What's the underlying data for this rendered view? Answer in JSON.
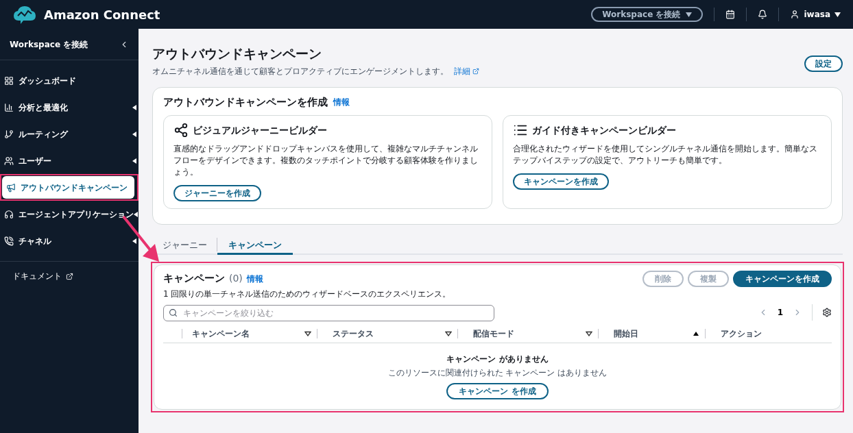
{
  "header": {
    "product": "Amazon Connect",
    "workspace_button": "Workspace を接続",
    "user": "iwasa"
  },
  "sidebar": {
    "title": "Workspace を接続",
    "items": [
      {
        "label": "ダッシュボード",
        "submenu": false,
        "selected": false,
        "annotated": false
      },
      {
        "label": "分析と最適化",
        "submenu": true,
        "selected": false,
        "annotated": false
      },
      {
        "label": "ルーティング",
        "submenu": true,
        "selected": false,
        "annotated": false
      },
      {
        "label": "ユーザー",
        "submenu": true,
        "selected": false,
        "annotated": false
      },
      {
        "label": "アウトバウンドキャンペーン",
        "submenu": false,
        "selected": true,
        "annotated": true
      },
      {
        "label": "エージェントアプリケーション",
        "submenu": true,
        "selected": false,
        "annotated": false
      },
      {
        "label": "チャネル",
        "submenu": true,
        "selected": false,
        "annotated": false
      }
    ],
    "doc_link": "ドキュメント"
  },
  "page": {
    "title": "アウトバウンドキャンペーン",
    "subtitle": "オムニチャネル通信を通じて顧客とプロアクティブにエンゲージメントします。",
    "detail_link": "詳細",
    "settings_button": "設定"
  },
  "create_card": {
    "title": "アウトバウンドキャンペーンを作成",
    "info": "情報",
    "builders": [
      {
        "title": "ビジュアルジャーニービルダー",
        "description": "直感的なドラッグアンドドロップキャンバスを使用して、複雑なマルチチャンネルフローをデザインできます。複数のタッチポイントで分岐する顧客体験を作りましょう。",
        "button": "ジャーニーを作成"
      },
      {
        "title": "ガイド付きキャンペーンビルダー",
        "description": "合理化されたウィザードを使用してシングルチャネル通信を開始します。簡単なステップバイステップの設定で、アウトリーチも簡単です。",
        "button": "キャンペーンを作成"
      }
    ]
  },
  "tabs": [
    {
      "label": "ジャーニー",
      "selected": false
    },
    {
      "label": "キャンペーン",
      "selected": true
    }
  ],
  "campaign_panel": {
    "title": "キャンペーン",
    "count": "(0)",
    "info": "情報",
    "description": "1 回限りの単一チャネル送信のためのウィザードベースのエクスペリエンス。",
    "annotated": true,
    "actions": [
      {
        "label": "削除",
        "kind": "secondary",
        "disabled": true
      },
      {
        "label": "複製",
        "kind": "secondary",
        "disabled": true
      },
      {
        "label": "キャンペーンを作成",
        "kind": "primary",
        "disabled": false
      }
    ],
    "filter": {
      "placeholder": "キャンペーンを絞り込む"
    },
    "page": "1",
    "columns": [
      {
        "label": "キャンペーン名",
        "kind": "filterable"
      },
      {
        "label": "ステータス",
        "kind": "filterable"
      },
      {
        "label": "配信モード",
        "kind": "filterable"
      },
      {
        "label": "開始日",
        "kind": "sorted"
      },
      {
        "label": "アクション",
        "kind": "plain"
      }
    ],
    "empty": {
      "title": "キャンペーン がありません",
      "message": "このリソースに関連付けられた キャンペーン はありません",
      "button": "キャンペーン を作成"
    }
  },
  "annotation": {
    "color": "#e8336e"
  }
}
